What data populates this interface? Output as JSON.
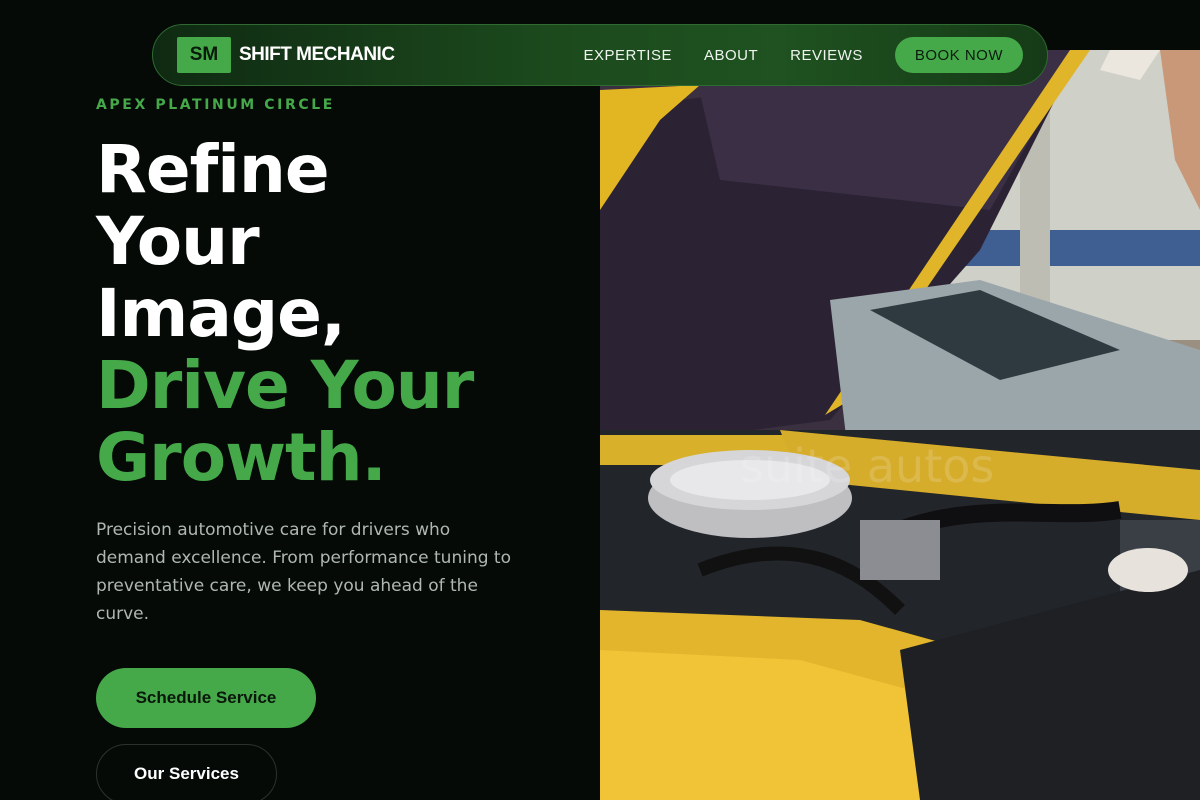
{
  "nav": {
    "logo_mark": "SM",
    "brand": "SHIFT MECHANIC",
    "links": [
      "EXPERTISE",
      "ABOUT",
      "REVIEWS"
    ],
    "cta": "BOOK NOW"
  },
  "hero": {
    "eyebrow": "APEX PLATINUM CIRCLE",
    "headline_white": [
      "Refine",
      "Your",
      "Image,"
    ],
    "headline_green": [
      "Drive Your",
      "Growth."
    ],
    "description": "Precision automotive care for drivers who demand excellence. From performance tuning to preventative care, we keep you ahead of the curve.",
    "primary_button": "Schedule Service",
    "secondary_button": "Our Services"
  },
  "image": {
    "subject": "yellow car with open hood, engine bay",
    "watermark": "suite autos"
  },
  "colors": {
    "accent": "#45a94a",
    "background": "#060a07",
    "body_text": "#aeb7b1"
  }
}
